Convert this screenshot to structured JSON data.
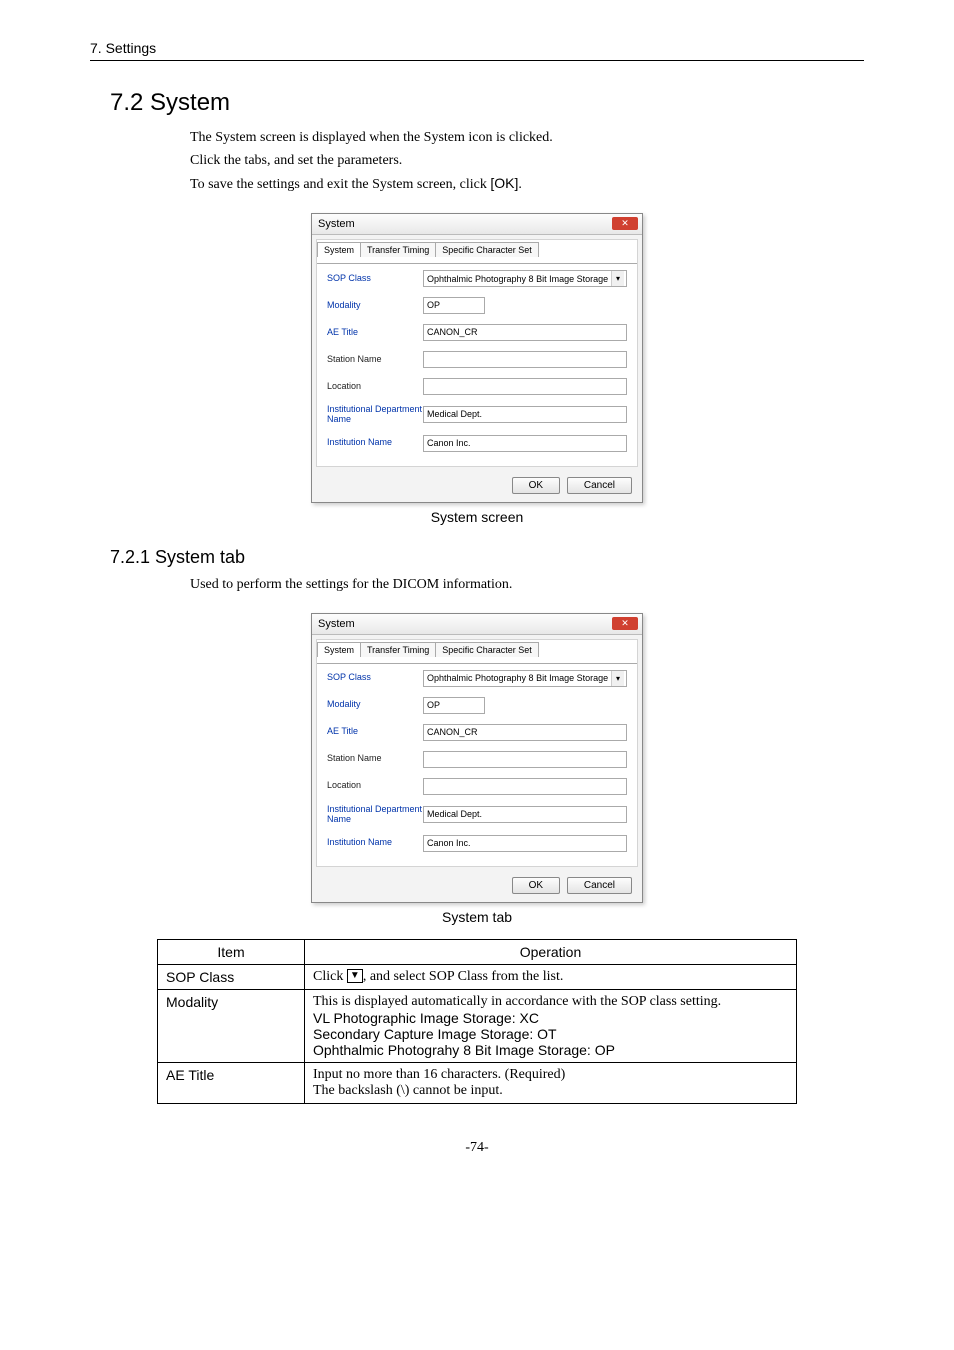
{
  "header": {
    "section_header": "7. Settings"
  },
  "section": {
    "h2": "7.2 System",
    "intro": [
      "The System screen is displayed when the System icon is clicked.",
      "Click the tabs, and set the parameters."
    ],
    "save_sentence_prefix": "To save the settings and exit the System screen, click ",
    "save_sentence_button": "[OK]",
    "save_sentence_suffix": "."
  },
  "dialog": {
    "title": "System",
    "close_glyph": "✕",
    "tabs": {
      "system": "System",
      "transfer": "Transfer Timing",
      "charset": "Specific Character Set"
    },
    "fields": {
      "sop_class": {
        "label": "SOP Class",
        "value": "Ophthalmic Photography 8 Bit Image Storage"
      },
      "modality": {
        "label": "Modality",
        "value": "OP"
      },
      "ae_title": {
        "label": "AE Title",
        "value": "CANON_CR"
      },
      "station_name": {
        "label": "Station Name",
        "value": ""
      },
      "location": {
        "label": "Location",
        "value": ""
      },
      "inst_dept": {
        "label": "Institutional Department Name",
        "value": "Medical Dept."
      },
      "inst_name": {
        "label": "Institution Name",
        "value": "Canon Inc."
      }
    },
    "buttons": {
      "ok": "OK",
      "cancel": "Cancel"
    },
    "caption_screen": "System screen",
    "caption_tab": "System tab"
  },
  "subsection": {
    "h3": "7.2.1 System tab",
    "intro": "Used to perform the settings for the DICOM information."
  },
  "table": {
    "headers": {
      "item": "Item",
      "operation": "Operation"
    },
    "rows": {
      "sop_class": {
        "item": "SOP Class",
        "op_prefix": "Click ",
        "op_icon": "▼",
        "op_suffix": ", and select SOP Class from the list."
      },
      "modality": {
        "item": "Modality",
        "line1": "This is displayed automatically in accordance with the SOP class setting.",
        "line2": "VL Photographic Image Storage: XC",
        "line3": "Secondary Capture Image Storage: OT",
        "line4": "Ophthalmic Photograhy 8 Bit Image Storage: OP"
      },
      "ae_title": {
        "item": "AE Title",
        "line1": "Input no more than 16 characters. (Required)",
        "line2": "The backslash (\\) cannot be input."
      }
    }
  },
  "page_number": "-74-"
}
